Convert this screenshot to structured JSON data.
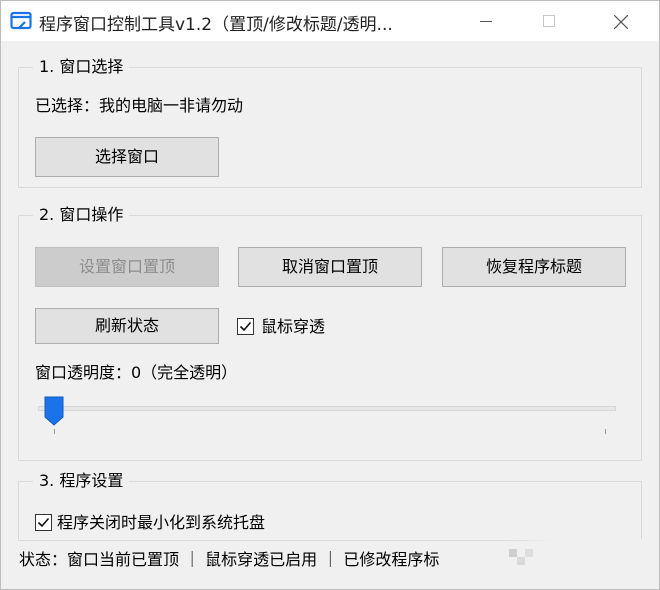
{
  "window": {
    "title": "程序窗口控制工具v1.2（置顶/修改标题/透明...",
    "accent": "#1a73e8"
  },
  "group1": {
    "legend": "1. 窗口选择",
    "selected_label": "已选择：我的电脑一非请勿动",
    "select_button": "选择窗口"
  },
  "group2": {
    "legend": "2. 窗口操作",
    "set_topmost_button": "设置窗口置顶",
    "cancel_topmost_button": "取消窗口置顶",
    "restore_title_button": "恢复程序标题",
    "refresh_button": "刷新状态",
    "mouse_through_label": "鼠标穿透",
    "mouse_through_checked": true,
    "opacity_label": "窗口透明度：0（完全透明）",
    "opacity_value": 0
  },
  "group3": {
    "legend": "3. 程序设置",
    "minimize_tray_label": "程序关闭时最小化到系统托盘",
    "minimize_tray_checked": true
  },
  "statusbar": {
    "text": "状态：窗口当前已置顶 ｜ 鼠标穿透已启用 ｜ 已修改程序标"
  },
  "icons": {
    "app": "app-window-icon",
    "minimize": "minimize-icon",
    "maximize": "maximize-icon",
    "close": "close-icon",
    "check": "check-icon"
  }
}
